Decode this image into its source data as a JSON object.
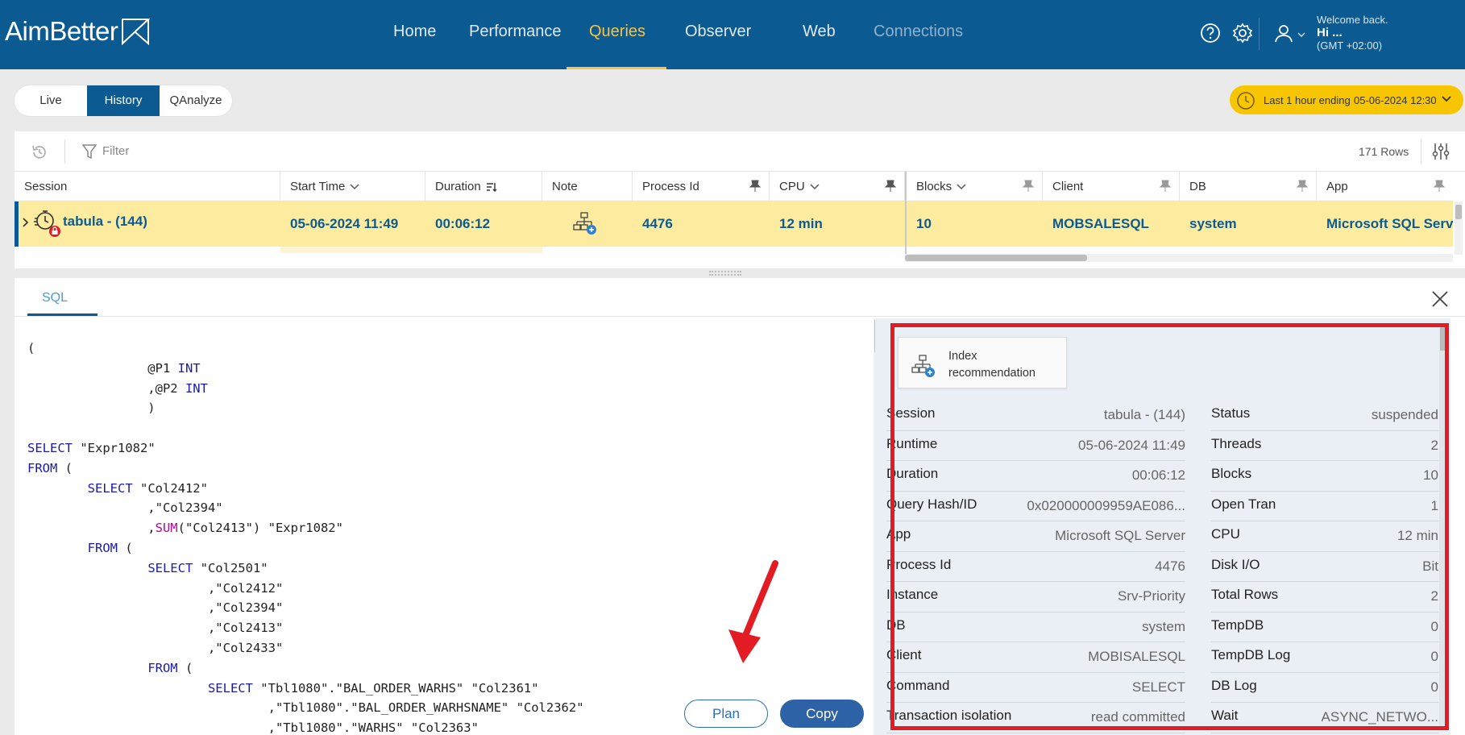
{
  "app": {
    "logo": "AimBetter",
    "nav": [
      "Home",
      "Performance",
      "Queries",
      "Observer",
      "Web",
      "Connections"
    ],
    "welcome": "Welcome back.",
    "user": "Hi ...",
    "timezone": "(GMT +02:00)"
  },
  "mode_tabs": [
    "Live",
    "History",
    "QAnalyze"
  ],
  "time_range": {
    "label": "Last 1 hour ending",
    "value": "05-06-2024 12:30"
  },
  "toolbar": {
    "filter": "Filter",
    "rows": "171 Rows"
  },
  "columns": [
    "Session",
    "Start Time",
    "Duration",
    "Note",
    "Process Id",
    "CPU",
    "Blocks",
    "Client",
    "DB",
    "App"
  ],
  "row": {
    "session": "tabula - (144)",
    "start_time": "05-06-2024 11:49",
    "duration": "00:06:12",
    "process_id": "4476",
    "cpu": "12 min",
    "blocks": "10",
    "client": "MOBSALESQL",
    "db": "system",
    "app": "Microsoft SQL Serve"
  },
  "detail": {
    "tab": "SQL",
    "plan_label": "Plan",
    "copy_label": "Copy",
    "index_recommendation": "Index recommendation"
  },
  "sql_lines": [
    "(",
    "                @P1 INT",
    "                ,@P2 INT",
    "                )",
    "",
    "SELECT \"Expr1082\"",
    "FROM (",
    "        SELECT \"Col2412\"",
    "                ,\"Col2394\"",
    "                ,SUM(\"Col2413\") \"Expr1082\"",
    "        FROM (",
    "                SELECT \"Col2501\"",
    "                        ,\"Col2412\"",
    "                        ,\"Col2394\"",
    "                        ,\"Col2413\"",
    "                        ,\"Col2433\"",
    "                FROM (",
    "                        SELECT \"Tbl1080\".\"BAL_ORDER_WARHS\" \"Col2361\"",
    "                                ,\"Tbl1080\".\"BAL_ORDER_WARHSNAME\" \"Col2362\"",
    "                                ,\"Tbl1080\".\"WARHS\" \"Col2363\""
  ],
  "info_left": [
    {
      "k": "Session",
      "v": "tabula - (144)"
    },
    {
      "k": "Runtime",
      "v": "05-06-2024 11:49"
    },
    {
      "k": "Duration",
      "v": "00:06:12"
    },
    {
      "k": "Query Hash/ID",
      "v": "0x020000009959AE086..."
    },
    {
      "k": "App",
      "v": "Microsoft SQL Server"
    },
    {
      "k": "Process Id",
      "v": "4476"
    },
    {
      "k": "Instance",
      "v": "Srv-Priority"
    },
    {
      "k": "DB",
      "v": "system"
    },
    {
      "k": "Client",
      "v": "MOBISALESQL"
    },
    {
      "k": "Command",
      "v": "SELECT"
    },
    {
      "k": "Transaction isolation",
      "v": "read committed"
    }
  ],
  "info_right": [
    {
      "k": "Status",
      "v": "suspended"
    },
    {
      "k": "Threads",
      "v": "2"
    },
    {
      "k": "Blocks",
      "v": "10"
    },
    {
      "k": "Open Tran",
      "v": "1"
    },
    {
      "k": "CPU",
      "v": "12 min"
    },
    {
      "k": "Disk I/O",
      "v": "Bit"
    },
    {
      "k": "Total Rows",
      "v": "2"
    },
    {
      "k": "TempDB",
      "v": "0"
    },
    {
      "k": "TempDB Log",
      "v": "0"
    },
    {
      "k": "DB Log",
      "v": "0"
    },
    {
      "k": "Wait",
      "v": "ASYNC_NETWO..."
    }
  ],
  "colors": {
    "brand": "#0b5b92",
    "accent": "#f6c343",
    "highlight": "#fdeba0",
    "annotation": "#e31c24"
  }
}
